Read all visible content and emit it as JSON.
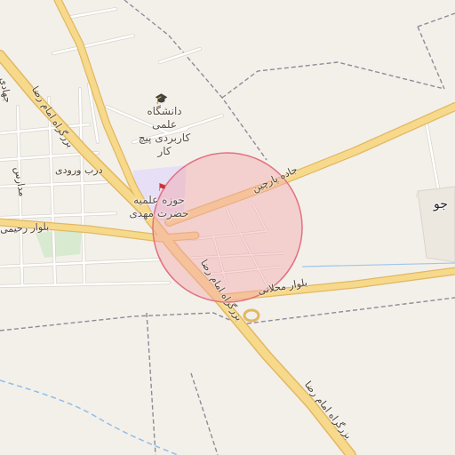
{
  "map": {
    "colors": {
      "background": "#f3f0ea",
      "highway": "#f7d98c",
      "highway_casing": "#e2b861",
      "minor_road": "#ffffff",
      "minor_road_casing": "#d9d4cc",
      "boundary": "#8f8a9a",
      "water": "#7fb3e6",
      "park": "#d8ead0",
      "campus": "#e6dff5",
      "search_circle_fill": "#f4a6ae",
      "search_circle_stroke": "#e2727f"
    },
    "pois": {
      "university": {
        "label": "دانشگاه علمی\nکاربردی پیچ کار",
        "icon": "graduation-cap-icon"
      },
      "seminary": {
        "label": "حوزه علمیه\nحضرت مهدی",
        "icon": "landmark-icon"
      }
    },
    "roads": {
      "imam_reza_north": "بزرگراه امام رضا",
      "imam_reza_center": "بزرگراه امام رضا",
      "imam_reza_south": "بزرگراه امام رضا",
      "jadeh_parchin": "جاده پارچین",
      "bolvar_mahallati": "بلوار محلاتی",
      "bolvar_rahimi": "بلوار رحیمی",
      "darb_vorudi": "درب ورودی",
      "west_street_1": "جهادی",
      "west_street_2": "مدارس"
    },
    "places": {
      "east_fragment": "جو"
    },
    "search_area": {
      "shape": "circle",
      "radius_label": ""
    }
  }
}
